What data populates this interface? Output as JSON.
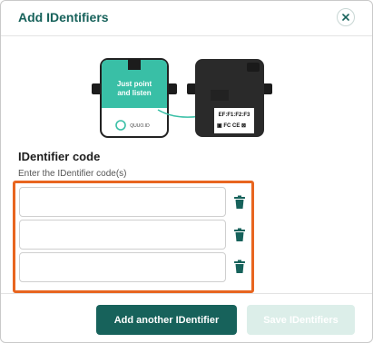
{
  "dialog": {
    "title": "Add IDentifiers"
  },
  "illustration": {
    "front_label_line1": "Just point",
    "front_label_line2": "and listen",
    "brand": "QUUO.ID",
    "back_code": "EF:F1:F2:F3"
  },
  "form": {
    "section_title": "IDentifier code",
    "section_subtitle": "Enter the IDentifier code(s)",
    "fields": [
      {
        "value": ""
      },
      {
        "value": ""
      },
      {
        "value": ""
      }
    ]
  },
  "footer": {
    "add_label": "Add another IDentifier",
    "save_label": "Save IDentifiers"
  },
  "colors": {
    "brand": "#17625b",
    "highlight": "#e8651f",
    "disabled": "#dceee9"
  }
}
